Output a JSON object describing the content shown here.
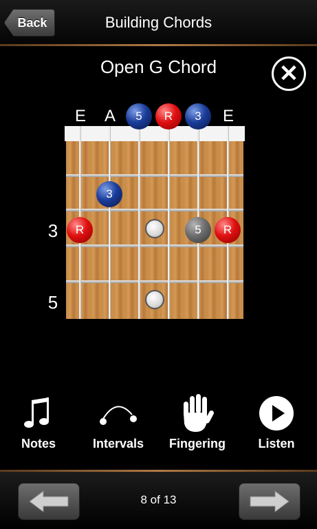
{
  "header": {
    "back_label": "Back",
    "title": "Building Chords"
  },
  "chord": {
    "name": "Open G Chord",
    "strings": [
      "E",
      "A",
      "5",
      "R",
      "3",
      "E"
    ],
    "fret_numbers": [
      "3",
      "5"
    ]
  },
  "fingering_dots": [
    {
      "string": 2,
      "fret": 0,
      "label": "5",
      "color": "#1a3d9a"
    },
    {
      "string": 3,
      "fret": 0,
      "label": "R",
      "color": "#e01010"
    },
    {
      "string": 4,
      "fret": 0,
      "label": "3",
      "color": "#1a3d9a"
    },
    {
      "string": 1,
      "fret": 2,
      "label": "3",
      "color": "#1a3d9a"
    },
    {
      "string": 0,
      "fret": 3,
      "label": "R",
      "color": "#e01010"
    },
    {
      "string": 4,
      "fret": 3,
      "label": "5",
      "color": "#6d6d6d"
    },
    {
      "string": 5,
      "fret": 3,
      "label": "R",
      "color": "#e01010"
    }
  ],
  "tools": [
    {
      "label": "Notes",
      "icon": "music-note-icon"
    },
    {
      "label": "Intervals",
      "icon": "interval-arc-icon"
    },
    {
      "label": "Fingering",
      "icon": "hand-icon"
    },
    {
      "label": "Listen",
      "icon": "play-icon"
    }
  ],
  "pagination": {
    "text": "8 of 13",
    "prev_icon": "arrow-left-icon",
    "next_icon": "arrow-right-icon"
  },
  "close_icon": "close-icon"
}
